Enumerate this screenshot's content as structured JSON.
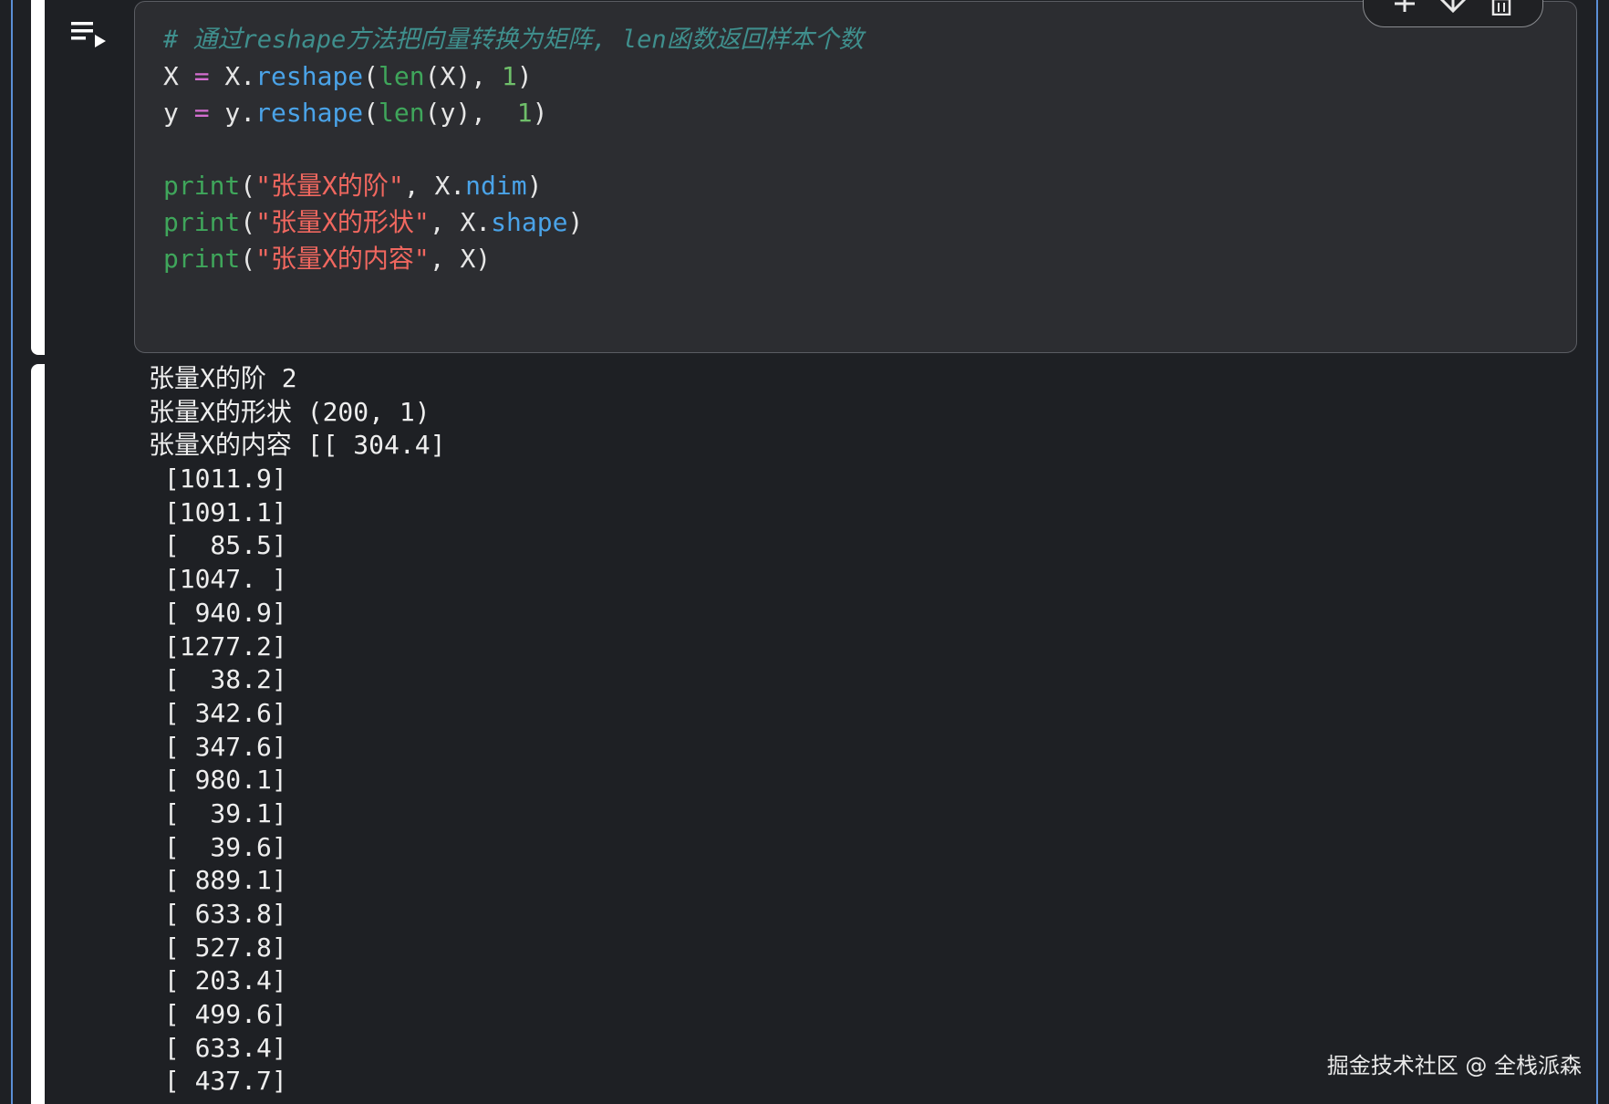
{
  "code_cell": {
    "lines": [
      {
        "type": "comment",
        "text": "# 通过reshape方法把向量转换为矩阵, len函数返回样本个数"
      },
      {
        "type": "code",
        "tokens": [
          {
            "t": "X ",
            "c": ""
          },
          {
            "t": "=",
            "c": "op"
          },
          {
            "t": " X.",
            "c": ""
          },
          {
            "t": "reshape",
            "c": "fn"
          },
          {
            "t": "(",
            "c": ""
          },
          {
            "t": "len",
            "c": "kw"
          },
          {
            "t": "(X), ",
            "c": ""
          },
          {
            "t": "1",
            "c": "num"
          },
          {
            "t": ")",
            "c": ""
          }
        ]
      },
      {
        "type": "code",
        "tokens": [
          {
            "t": "y ",
            "c": ""
          },
          {
            "t": "=",
            "c": "op"
          },
          {
            "t": " y.",
            "c": ""
          },
          {
            "t": "reshape",
            "c": "fn"
          },
          {
            "t": "(",
            "c": ""
          },
          {
            "t": "len",
            "c": "kw"
          },
          {
            "t": "(y),  ",
            "c": ""
          },
          {
            "t": "1",
            "c": "num"
          },
          {
            "t": ")",
            "c": ""
          }
        ]
      },
      {
        "type": "blank",
        "tokens": []
      },
      {
        "type": "code",
        "tokens": [
          {
            "t": "print",
            "c": "kw"
          },
          {
            "t": "(",
            "c": ""
          },
          {
            "t": "\"张量X的阶\"",
            "c": "str"
          },
          {
            "t": ", X.",
            "c": ""
          },
          {
            "t": "ndim",
            "c": "fn"
          },
          {
            "t": ")",
            "c": ""
          }
        ]
      },
      {
        "type": "code",
        "tokens": [
          {
            "t": "print",
            "c": "kw"
          },
          {
            "t": "(",
            "c": ""
          },
          {
            "t": "\"张量X的形状\"",
            "c": "str"
          },
          {
            "t": ", X.",
            "c": ""
          },
          {
            "t": "shape",
            "c": "fn"
          },
          {
            "t": ")",
            "c": ""
          }
        ]
      },
      {
        "type": "code",
        "tokens": [
          {
            "t": "print",
            "c": "kw"
          },
          {
            "t": "(",
            "c": ""
          },
          {
            "t": "\"张量X的内容\"",
            "c": "str"
          },
          {
            "t": ", X)",
            "c": ""
          }
        ]
      }
    ]
  },
  "output": {
    "lines": [
      "张量X的阶 2",
      "张量X的形状 (200, 1)",
      "张量X的内容 [[ 304.4]",
      " [1011.9]",
      " [1091.1]",
      " [  85.5]",
      " [1047. ]",
      " [ 940.9]",
      " [1277.2]",
      " [  38.2]",
      " [ 342.6]",
      " [ 347.6]",
      " [ 980.1]",
      " [  39.1]",
      " [  39.6]",
      " [ 889.1]",
      " [ 633.8]",
      " [ 527.8]",
      " [ 203.4]",
      " [ 499.6]",
      " [ 633.4]",
      " [ 437.7]"
    ]
  },
  "toolbar": {
    "icons": [
      "arrow-up-icon",
      "arrow-down-icon",
      "delete-icon"
    ]
  },
  "watermark": "掘金技术社区 @ 全栈派森",
  "colors": {
    "background": "#1e2024",
    "cell_background": "#2c2d31",
    "comment": "#3f8f8d",
    "keyword": "#3fa65b",
    "function": "#4aa3e8",
    "string": "#f0675f",
    "number": "#6fbf6a",
    "operator": "#d46ed0"
  }
}
